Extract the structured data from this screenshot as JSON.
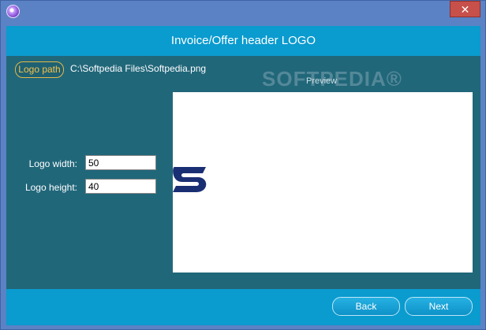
{
  "window": {
    "close_glyph": "✕",
    "app_icon": "app-globe-icon"
  },
  "header": {
    "title": "Invoice/Offer header LOGO"
  },
  "logo": {
    "path_button_label": "Logo path",
    "path_value": "C:\\Softpedia Files\\Softpedia.png",
    "width_label": "Logo width:",
    "width_value": "50",
    "height_label": "Logo height:",
    "height_value": "40"
  },
  "preview": {
    "label": "Preview"
  },
  "watermark": {
    "text": "SOFTPEDIA®"
  },
  "footer": {
    "back_label": "Back",
    "next_label": "Next"
  },
  "colors": {
    "frame": "#5b82c4",
    "header": "#0a9bcf",
    "panel": "#21677a",
    "accent": "#f6c24a"
  }
}
